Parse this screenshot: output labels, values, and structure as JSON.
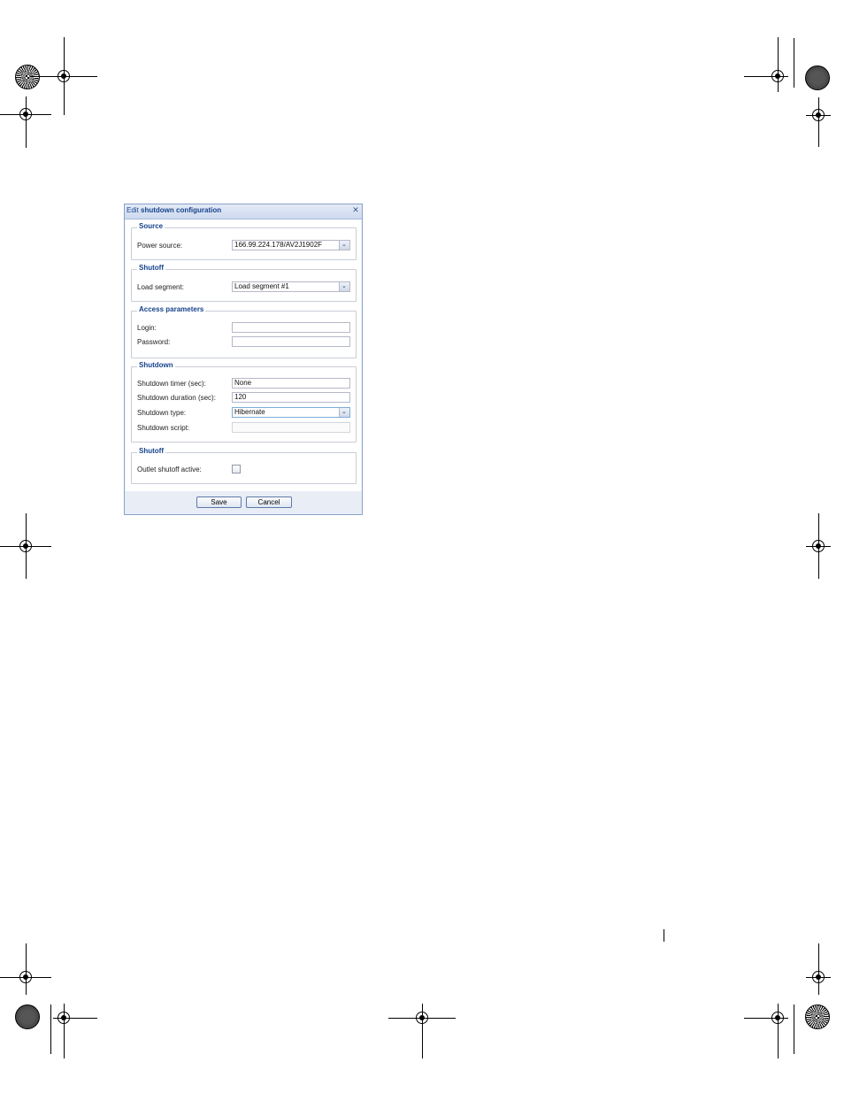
{
  "dialog": {
    "title_prefix": "Edit ",
    "title_bold": "shutdown configuration",
    "close_glyph": "✕"
  },
  "source": {
    "legend": "Source",
    "power_source_label": "Power source:",
    "power_source_value": "166.99.224.178/AV2J1902F"
  },
  "shutoff": {
    "legend": "Shutoff",
    "load_segment_label": "Load segment:",
    "load_segment_value": "Load segment #1"
  },
  "access": {
    "legend": "Access parameters",
    "login_label": "Login:",
    "login_value": "",
    "password_label": "Password:",
    "password_value": ""
  },
  "shutdown": {
    "legend": "Shutdown",
    "timer_label": "Shutdown timer (sec):",
    "timer_value": "None",
    "duration_label": "Shutdown duration (sec):",
    "duration_value": "120",
    "type_label": "Shutdown type:",
    "type_value": "Hibernate",
    "script_label": "Shutdown script:",
    "script_value": ""
  },
  "outlet": {
    "legend": "Shutoff",
    "active_label": "Outlet shutoff active:",
    "active_checked": false
  },
  "buttons": {
    "save": "Save",
    "cancel": "Cancel"
  },
  "icons": {
    "dropdown": "chevron-down-icon",
    "close": "close-icon"
  }
}
